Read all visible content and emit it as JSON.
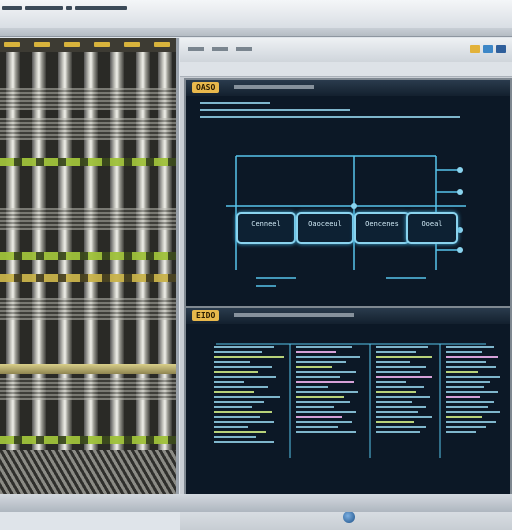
{
  "window": {
    "app_title": "",
    "controls": [
      {
        "icon": "minimize-icon",
        "color": "#e2b23a"
      },
      {
        "icon": "maximize-icon",
        "color": "#3d87c7"
      },
      {
        "icon": "close-icon",
        "color": "#2f5f9b"
      }
    ]
  },
  "top_panel": {
    "tag": "OASO",
    "nodes": [
      {
        "label": "Cenneel"
      },
      {
        "label": "Oaoceeul"
      },
      {
        "label": "Oencenes"
      },
      {
        "label": "Ooeal"
      }
    ]
  },
  "bottom_panel": {
    "tag": "EIDO"
  },
  "colors": {
    "panel_bg": "#0c1826",
    "diagram_line": "#56c3ea",
    "node_border": "#8ad3ee",
    "tag": "#e8b84c",
    "accent_green": "#9fc13a"
  }
}
